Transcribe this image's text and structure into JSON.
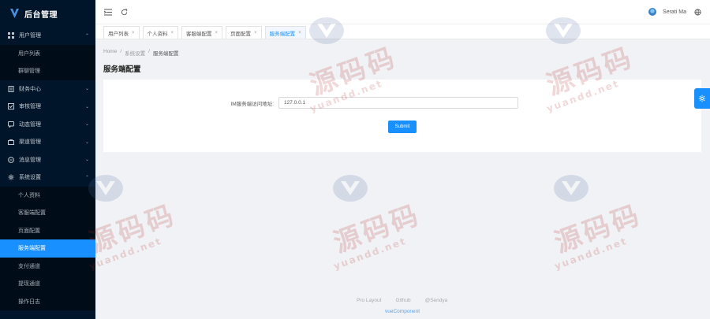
{
  "brand": {
    "title": "后台管理",
    "accent": "#1890ff",
    "sidebar_bg": "#001529"
  },
  "sidebar": {
    "groups": [
      {
        "icon": "grid-icon",
        "label": "用户管理",
        "arrow": "⌃",
        "children": [
          "用户列表",
          "群聊管理"
        ]
      },
      {
        "icon": "document-icon",
        "label": "财务中心",
        "arrow": "⌄"
      },
      {
        "icon": "check-square-icon",
        "label": "审核管理",
        "arrow": "⌄"
      },
      {
        "icon": "chat-icon",
        "label": "动态管理",
        "arrow": "⌄"
      },
      {
        "icon": "bag-icon",
        "label": "渠道管理",
        "arrow": "⌄"
      },
      {
        "icon": "message-circle-icon",
        "label": "消息管理",
        "arrow": "⌄"
      },
      {
        "icon": "gear-icon",
        "label": "系统设置",
        "arrow": "⌃",
        "children": [
          "个人资料",
          "客服端配置",
          "页面配置",
          "服务端配置",
          "支付通道",
          "提现通道",
          "操作日志"
        ],
        "active_child": "服务端配置"
      }
    ]
  },
  "header": {
    "user_name": "Serati Ma"
  },
  "tabs": [
    {
      "label": "用户列表",
      "active": false
    },
    {
      "label": "个人资料",
      "active": false
    },
    {
      "label": "客服端配置",
      "active": false
    },
    {
      "label": "页面配置",
      "active": false
    },
    {
      "label": "服务端配置",
      "active": true
    }
  ],
  "breadcrumb": {
    "items": [
      "Home",
      "系统设置",
      "服务端配置"
    ],
    "sep": "/"
  },
  "page_title": "服务端配置",
  "form": {
    "label": "IM服务端访问地址:",
    "value": "127.0.0.1",
    "submit_label": "Submit"
  },
  "footer": {
    "links": [
      "Pro Layout",
      "Github",
      "@Sendya"
    ],
    "copyright": "vueComponent"
  },
  "watermark": {
    "cn": "源码码",
    "en": "yuandd.net"
  }
}
